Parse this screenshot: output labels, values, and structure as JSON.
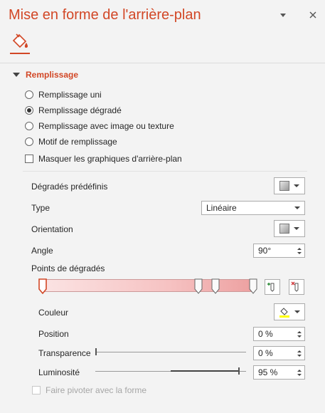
{
  "pane": {
    "title": "Mise en forme de l'arrière-plan",
    "menu_icon": "chevron-down-icon",
    "close_icon": "close-icon",
    "tab_icon": "fill-bucket-icon"
  },
  "section": {
    "title": "Remplissage"
  },
  "fill_options": [
    {
      "label": "Remplissage uni",
      "selected": false
    },
    {
      "label": "Remplissage dégradé",
      "selected": true
    },
    {
      "label": "Remplissage avec image ou texture",
      "selected": false
    },
    {
      "label": "Motif de remplissage",
      "selected": false
    }
  ],
  "hide_graphics": {
    "label": "Masquer les graphiques d'arrière-plan",
    "checked": false
  },
  "preset": {
    "label": "Dégradés prédéfinis"
  },
  "type": {
    "label": "Type",
    "value": "Linéaire"
  },
  "orientation": {
    "label": "Orientation"
  },
  "angle": {
    "label": "Angle",
    "value": "90°"
  },
  "stops": {
    "label": "Points de dégradés",
    "positions": [
      0,
      74,
      82,
      100
    ],
    "gradient_colors": [
      "#fbe3e3",
      "#eda1a1"
    ],
    "add_icon": "add-gradient-stop-icon",
    "remove_icon": "remove-gradient-stop-icon"
  },
  "color": {
    "label": "Couleur",
    "icon": "paint-bucket-icon",
    "accent": "#ffff00"
  },
  "position": {
    "label": "Position",
    "value": "0 %"
  },
  "transparency": {
    "label": "Transparence",
    "value": "0 %",
    "level": 0
  },
  "brightness": {
    "label": "Luminosité",
    "value": "95 %",
    "level": 95
  },
  "rotate_with_shape": {
    "label": "Faire pivoter avec la forme",
    "checked": false,
    "disabled": true
  },
  "colors": {
    "accent": "#d24726",
    "background": "#f3f3f3"
  }
}
